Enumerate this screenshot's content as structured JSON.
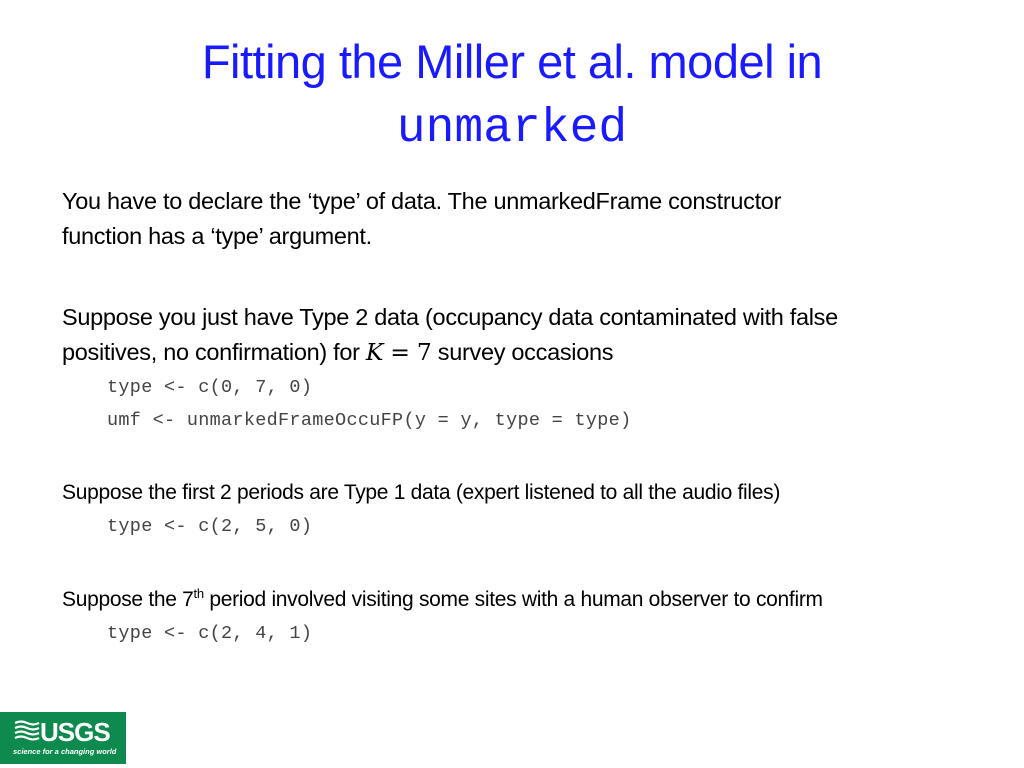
{
  "title": {
    "line1": "Fitting the Miller et al. model in",
    "line2": "unmarked",
    "color": "#1a1aff"
  },
  "paragraphs": [
    {
      "text_line1": "You have to declare the ‘type’ of data.  The unmarkedFrame constructor",
      "text_line2": "function has a ‘type’ argument."
    },
    {
      "text_line1": "Suppose you just have Type 2 data (occupancy data contaminated with false",
      "text_line2_before": "positives, no confirmation) for ",
      "math_var": "K",
      "math_eq": " = 7",
      "text_line2_after": " survey occasions",
      "code": [
        "type <- c(0, 7, 0)",
        "umf <- unmarkedFrameOccuFP(y = y, type = type)"
      ]
    },
    {
      "text": "Suppose the first 2 periods are Type 1 data  (expert listened to all the audio files)",
      "code": [
        "type <- c(2, 5, 0)"
      ]
    },
    {
      "text_before": "Suppose the 7",
      "sup": "th",
      "text_after": " period involved visiting some sites with a human observer to confirm",
      "code": [
        "type <- c(2, 4, 1)"
      ]
    }
  ],
  "logo": {
    "name": "USGS",
    "tagline": "science for a changing world",
    "color": "#0e8a4f"
  }
}
